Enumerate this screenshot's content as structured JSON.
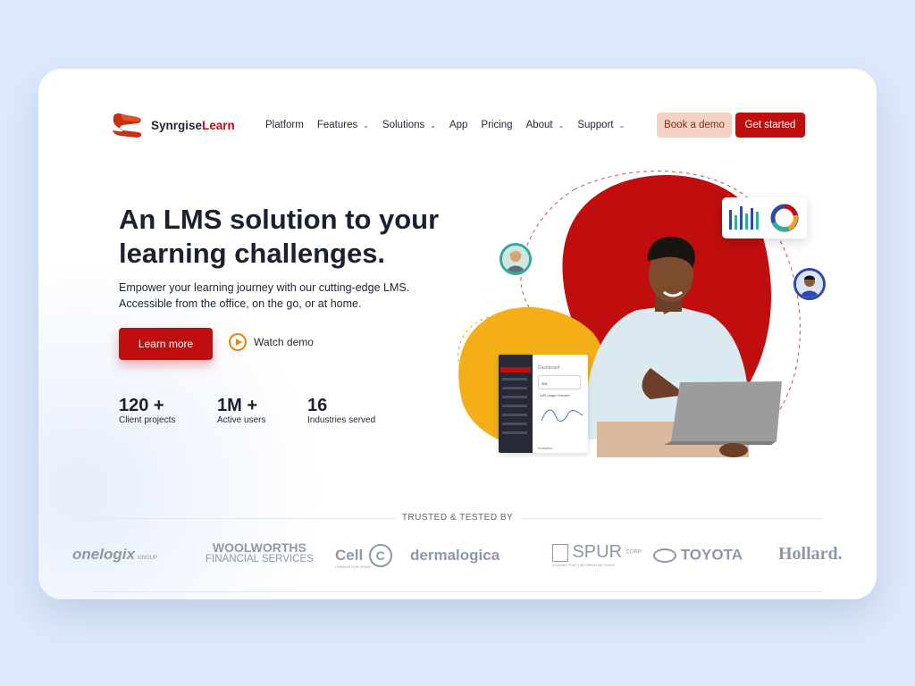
{
  "brand": {
    "name_dark": "Synrgise",
    "name_accent": "Learn",
    "accent_color": "#c00d0d"
  },
  "nav": {
    "items": [
      {
        "label": "Platform",
        "dropdown": false
      },
      {
        "label": "Features",
        "dropdown": true
      },
      {
        "label": "Solutions",
        "dropdown": true
      },
      {
        "label": "App",
        "dropdown": false
      },
      {
        "label": "Pricing",
        "dropdown": false
      },
      {
        "label": "About",
        "dropdown": true
      },
      {
        "label": "Support",
        "dropdown": true
      }
    ],
    "book_demo": "Book a demo",
    "get_started": "Get started"
  },
  "hero": {
    "headline": "An LMS solution to your learning challenges.",
    "sub_line1": "Empower your learning journey with our cutting-edge LMS.",
    "sub_line2": "Accessible from the office, on the go, or at home.",
    "learn_more": "Learn more",
    "watch_demo": "Watch demo"
  },
  "stats": [
    {
      "value": "120 +",
      "label": "Client projects"
    },
    {
      "value": "1M +",
      "label": "Active users"
    },
    {
      "value": "16",
      "label": "Industries served"
    }
  ],
  "dashboard_preview": {
    "title": "Dashboard",
    "section": "LMS Usage Overview",
    "stat_value": "201",
    "footer": "Analytics"
  },
  "trusted": {
    "heading": "TRUSTED & TESTED BY",
    "logos": {
      "onelogix": "onelogix",
      "onelogix_sub": "GROUP",
      "woolworths_1": "WOOLWORTHS",
      "woolworths_2": "FINANCIAL SERVICES",
      "cellc": "Cell",
      "cellc_mark": "C",
      "cellc_tag": "CHANGE FOR GOOD",
      "dermalogica": "dermalogica",
      "spur": "SPUR",
      "spur_tag": "LEADING FOR THE GREATER GOOD",
      "spur_corp": "CORP",
      "toyota": "TOYOTA",
      "hollard": "Hollard."
    }
  },
  "colors": {
    "primary": "#c00d0d",
    "orange": "#f2a11a",
    "page_bg": "#dde9fb",
    "blue": "#2f49a8",
    "teal": "#2eae9a"
  }
}
